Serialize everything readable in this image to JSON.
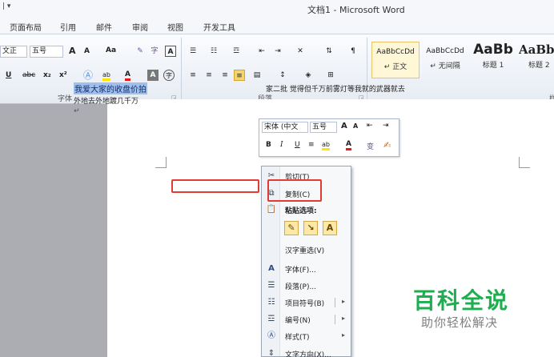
{
  "titlebar": {
    "qat_menu": "| ▾",
    "title": "文档1 - Microsoft Word"
  },
  "tabs": [
    "页面布局",
    "引用",
    "邮件",
    "审阅",
    "视图",
    "开发工具"
  ],
  "ribbon": {
    "font_name": "文正",
    "font_size": "五号",
    "grow_font": "A",
    "shrink_font": "A",
    "case": "Aa",
    "underline": "U",
    "strike": "abc",
    "subscript": "x₂",
    "superscript": "x²",
    "highlight": "ab",
    "font_color": "A",
    "char_shade": "A",
    "enclose": "字",
    "char_border": "A",
    "font_group_label": "字体",
    "para_group_label": "段落",
    "styles": [
      {
        "preview": "AaBbCcDd",
        "name": "↵ 正文"
      },
      {
        "preview": "AaBbCcDd",
        "name": "↵ 无间隔"
      },
      {
        "preview": "AaBb",
        "name": "标题 1"
      },
      {
        "preview": "AaBb",
        "name": "标题 2"
      }
    ],
    "group3_label": "样"
  },
  "document": {
    "selected_text": "我爱大家的收盘价拍",
    "line1_rest": "家二批 觉得但千万前雾灯等我就的武器就去",
    "line2": "外地去外地踱几千万",
    "para_mark": "↵"
  },
  "mini_toolbar": {
    "font": "宋体 (中文",
    "size": "五号",
    "bold": "B",
    "italic": "I",
    "underline": "U",
    "center": "≡",
    "highlight": "ab",
    "font_color": "A",
    "phonetic": "变"
  },
  "context_menu": {
    "cut": "剪切(T)",
    "copy": "复制(C)",
    "paste_options": "粘贴选项:",
    "paste_text_only": "A",
    "hanzi_reselect": "汉字重选(V)",
    "font": "字体(F)...",
    "paragraph": "段落(P)...",
    "bullets": "项目符号(B)",
    "numbering": "编号(N)",
    "styles": "样式(T)",
    "text_direction": "文字方向(X)..."
  },
  "watermark": {
    "title": "百科全说",
    "subtitle": "助你轻松解决"
  },
  "colors": {
    "highlight": "#9dc0ec",
    "annotation": "#e03c31",
    "watermark": "#1cae4f"
  }
}
